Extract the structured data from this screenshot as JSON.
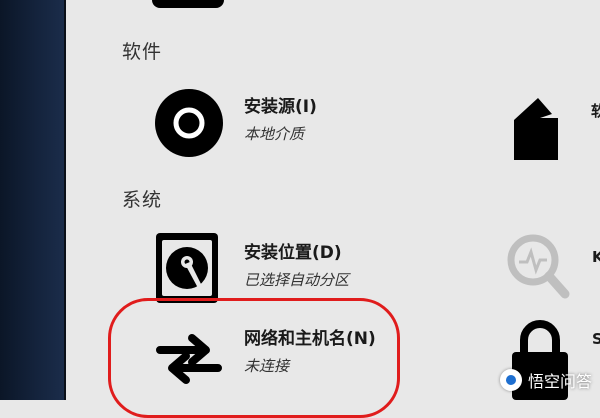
{
  "sections": {
    "software": {
      "heading": "软件"
    },
    "system": {
      "heading": "系统"
    }
  },
  "spokes": {
    "install_source": {
      "title": "安装源(I)",
      "status": "本地介质",
      "icon": "disc-icon"
    },
    "install_destination": {
      "title": "安装位置(D)",
      "status": "已选择自动分区",
      "icon": "hard-drive-icon"
    },
    "network_hostname": {
      "title": "网络和主机名(N)",
      "status": "未连接",
      "icon": "network-arrows-icon"
    }
  },
  "right_column": {
    "top_label_fragment": "软",
    "middle_label_fragment": "K",
    "bottom_label_fragment": "S",
    "icons": [
      "package-icon",
      "search-icon",
      "lock-icon"
    ]
  },
  "highlight": {
    "color": "#e01c1c"
  },
  "watermark": {
    "text": "悟空问答"
  }
}
